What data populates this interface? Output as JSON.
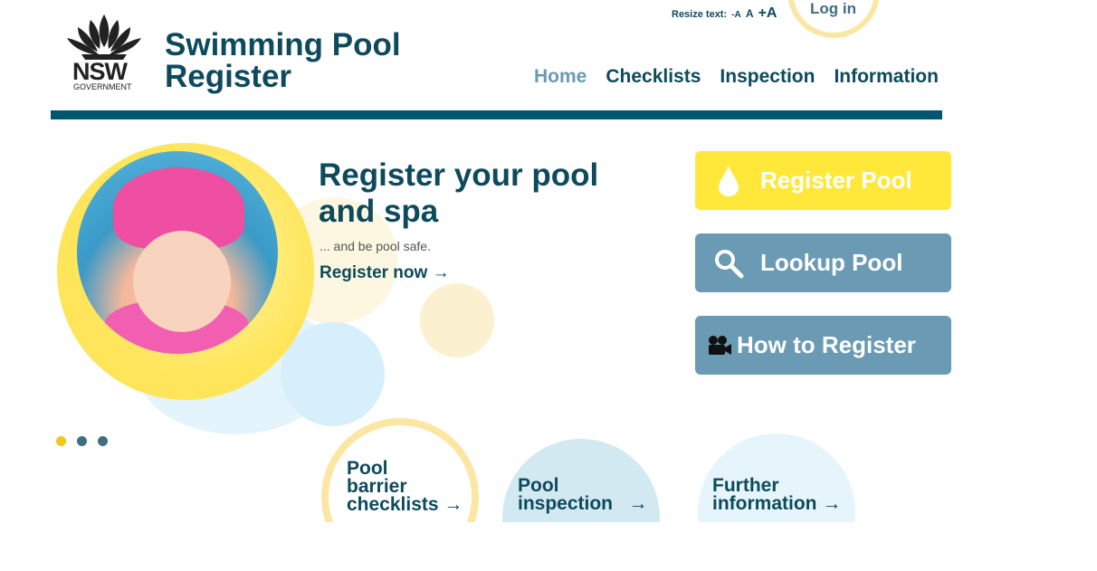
{
  "brand": {
    "gov_short": "NSW",
    "gov_long": "GOVERNMENT",
    "site_title_line1": "Swimming Pool",
    "site_title_line2": "Register"
  },
  "utility": {
    "resize_label": "Resize text:",
    "size_small": "-A",
    "size_medium": "A",
    "size_large": "+A",
    "login": "Log in"
  },
  "nav": {
    "items": [
      {
        "label": "Home",
        "active": true
      },
      {
        "label": "Checklists",
        "active": false
      },
      {
        "label": "Inspection",
        "active": false
      },
      {
        "label": "Information",
        "active": false
      }
    ]
  },
  "hero": {
    "title_line1": "Register your pool",
    "title_line2": "and spa",
    "subtitle": "... and be pool safe.",
    "link": "Register now",
    "slides_count": 3,
    "active_slide": 1
  },
  "actions": {
    "register": "Register Pool",
    "lookup": "Lookup Pool",
    "howto": "How to Register"
  },
  "tiles": {
    "checklists_l1": "Pool",
    "checklists_l2": "barrier",
    "checklists_l3": "checklists",
    "inspection_l1": "Pool",
    "inspection_l2": "inspection",
    "further_l1": "Further",
    "further_l2": "information"
  },
  "colors": {
    "primary": "#0d4a5c",
    "rule": "#00566e",
    "yellow": "#ffe83a",
    "blue_button": "#6a9ab4",
    "active_nav": "#6a9ab4",
    "dot_active": "#f2c521",
    "dot_inactive": "#3f6e83"
  },
  "icons": {
    "register": "water-drop-icon",
    "lookup": "magnifier-icon",
    "howto": "video-camera-icon",
    "arrow": "arrow-right-icon"
  }
}
